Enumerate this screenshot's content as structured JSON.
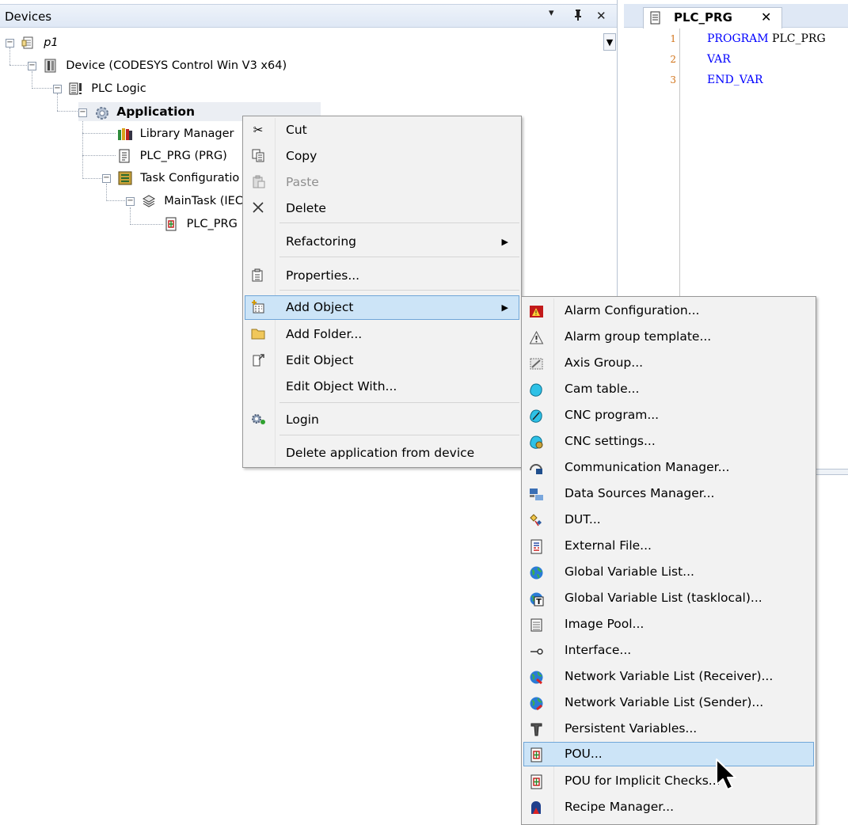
{
  "devices_panel": {
    "title": "Devices",
    "header_buttons": {
      "dropdown": "▾",
      "pin": "ᵠ",
      "close": "✕"
    },
    "tree": {
      "project": "p1",
      "device": "Device (CODESYS Control Win V3 x64)",
      "plc_logic": "PLC Logic",
      "application": "Application",
      "library_manager": "Library Manager",
      "plc_prg": "PLC_PRG (PRG)",
      "task_configuration": "Task Configuratio",
      "main_task": "MainTask (IEC",
      "main_task_plc_prg": "PLC_PRG"
    }
  },
  "editor": {
    "tab_label": "PLC_PRG",
    "lines": [
      {
        "num": "1",
        "kw": "PROGRAM",
        "rest": " PLC_PRG"
      },
      {
        "num": "2",
        "kw": "VAR",
        "rest": ""
      },
      {
        "num": "3",
        "kw": "END_VAR",
        "rest": ""
      }
    ]
  },
  "context_menu": {
    "cut": "Cut",
    "copy": "Copy",
    "paste": "Paste",
    "delete": "Delete",
    "refactoring": "Refactoring",
    "properties": "Properties...",
    "add_object": "Add Object",
    "add_folder": "Add Folder...",
    "edit_object": "Edit Object",
    "edit_object_with": "Edit Object With...",
    "login": "Login",
    "delete_application": "Delete application from device"
  },
  "submenu": {
    "items": [
      "Alarm Configuration...",
      "Alarm group template...",
      "Axis Group...",
      "Cam table...",
      "CNC program...",
      "CNC settings...",
      "Communication Manager...",
      "Data Sources Manager...",
      "DUT...",
      "External File...",
      "Global Variable List...",
      "Global Variable List (tasklocal)...",
      "Image Pool...",
      "Interface...",
      "Network Variable List (Receiver)...",
      "Network Variable List (Sender)...",
      "Persistent Variables...",
      "POU...",
      "POU for Implicit Checks...",
      "Recipe Manager..."
    ],
    "highlighted": "POU..."
  },
  "colors": {
    "menu_bg": "#f2f2f2",
    "highlight": "#cce4f7",
    "highlight_border": "#6fa6d8",
    "keyword": "#0000ff",
    "line_number": "#d2741a"
  }
}
